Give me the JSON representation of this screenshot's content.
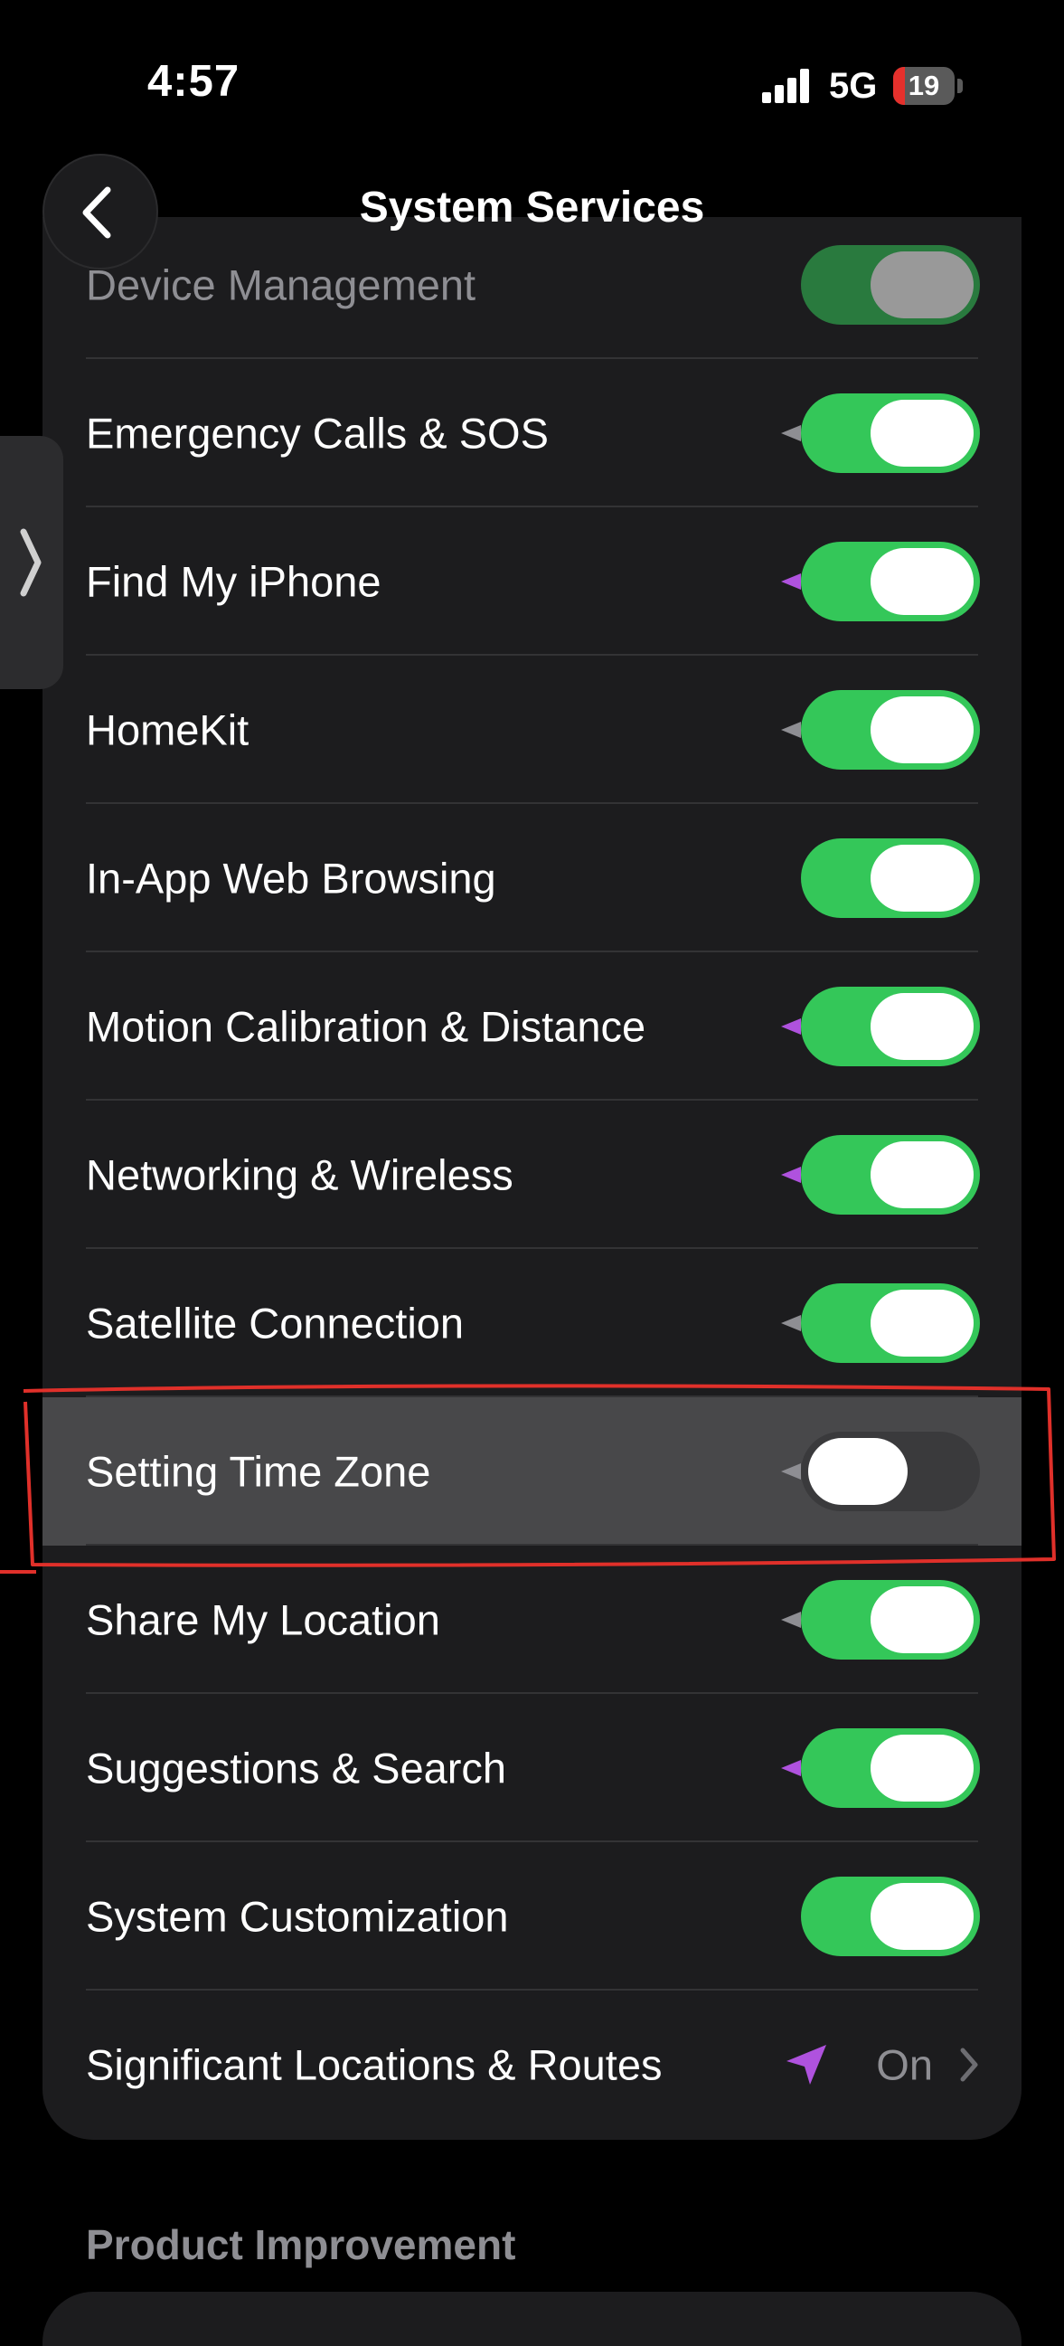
{
  "status_bar": {
    "time": "4:57",
    "network": "5G",
    "battery": {
      "level": "19",
      "fraction": 0.19,
      "color": "#e5302c"
    }
  },
  "nav": {
    "title": "System Services",
    "back_icon": "chevron-left-icon"
  },
  "side_handle": {
    "icon": "chevron-right-icon"
  },
  "rows": [
    {
      "label": "Device Management",
      "on": true,
      "indicator": "none"
    },
    {
      "label": "Emergency Calls & SOS",
      "on": true,
      "indicator": "gray"
    },
    {
      "label": "Find My iPhone",
      "on": true,
      "indicator": "purple"
    },
    {
      "label": "HomeKit",
      "on": true,
      "indicator": "gray"
    },
    {
      "label": "In-App Web Browsing",
      "on": true,
      "indicator": "none"
    },
    {
      "label": "Motion Calibration & Distance",
      "on": true,
      "indicator": "purple"
    },
    {
      "label": "Networking & Wireless",
      "on": true,
      "indicator": "purple"
    },
    {
      "label": "Satellite Connection",
      "on": true,
      "indicator": "gray"
    },
    {
      "label": "Setting Time Zone",
      "on": false,
      "indicator": "gray",
      "highlighted": true
    },
    {
      "label": "Share My Location",
      "on": true,
      "indicator": "gray"
    },
    {
      "label": "Suggestions & Search",
      "on": true,
      "indicator": "purple"
    },
    {
      "label": "System Customization",
      "on": true,
      "indicator": "none"
    }
  ],
  "detail_row": {
    "label": "Significant Locations & Routes",
    "value": "On",
    "icon": "location-arrow-icon"
  },
  "section_header": "Product Improvement",
  "colors": {
    "toggle_on": "#34c759",
    "toggle_off": "#3a3a3c",
    "location_purple": "#af52de",
    "annotation_red": "#e0302a"
  }
}
